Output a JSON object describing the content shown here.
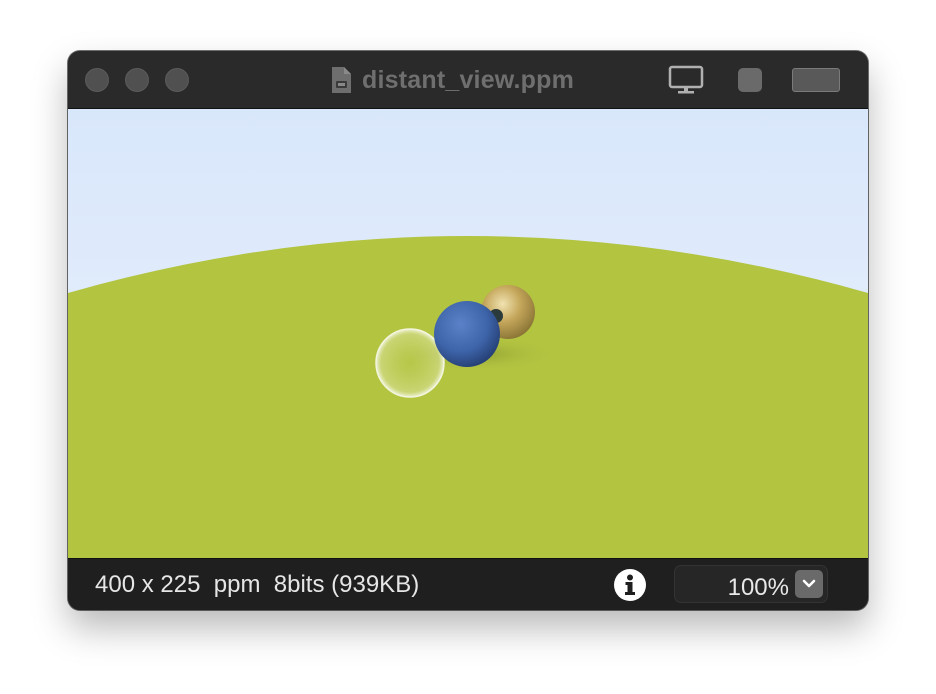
{
  "window": {
    "title": "distant_view.ppm",
    "icons": [
      "doc-icon",
      "monitor-icon",
      "square-icon",
      "toggle-bar-icon"
    ]
  },
  "image": {
    "description_icon": "rendered-scene",
    "colors": {
      "sky_top": "#dbe8fb",
      "sky_bottom": "#e7f0fc",
      "ground": "#b3c441",
      "blue_sphere": "#3e64a8",
      "gold_sphere": "#b89b4a"
    }
  },
  "status": {
    "info_text": "400 x 225  ppm  8bits (939KB)",
    "zoom_value": "100%"
  },
  "colors": {
    "titlebar_bg": "#2a2a2a",
    "statusbar_bg": "#1f1f1f",
    "title_text": "#6f6f6f"
  }
}
